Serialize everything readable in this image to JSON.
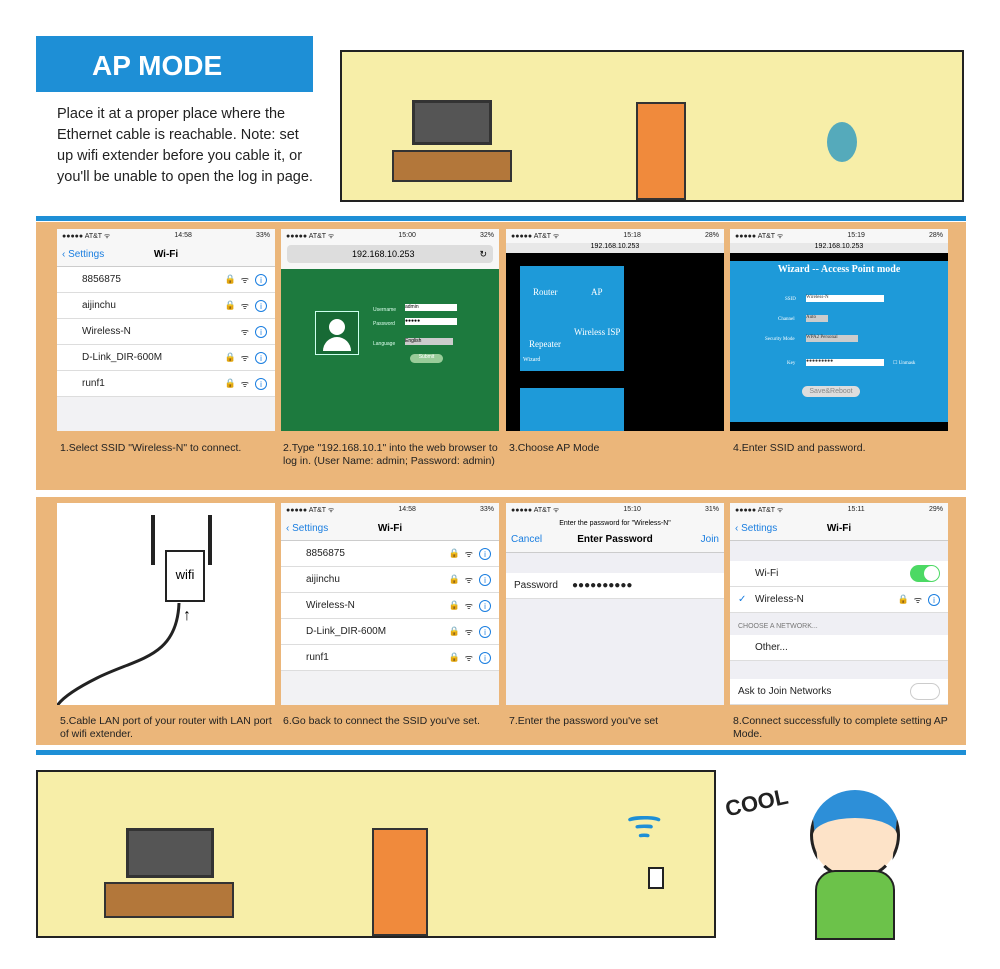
{
  "header": {
    "title": "AP MODE",
    "intro": "Place it at a proper place where the Ethernet cable is reachable. Note: set up wifi extender before you cable it, or you'll be unable to open the log in page."
  },
  "status": {
    "carrier": "●●●●● AT&T ᯤ"
  },
  "steps": [
    {
      "caption": "1.Select SSID \"Wireless-N\" to connect.",
      "time": "14:58",
      "battery": "33%",
      "back": "Settings",
      "title": "Wi-Fi",
      "networks": [
        "8856875",
        "aijinchu",
        "Wireless-N",
        "D-Link_DIR-600M",
        "runf1"
      ]
    },
    {
      "caption": "2.Type \"192.168.10.1\" into the web browser to log in. (User Name: admin; Password: admin)",
      "time": "15:00",
      "battery": "32%",
      "url": "192.168.10.253",
      "username_label": "Username",
      "username": "admin",
      "password_label": "Password",
      "password": "●●●●●",
      "language_label": "Language",
      "language": "English",
      "submit": "Submit"
    },
    {
      "caption": "3.Choose AP Mode",
      "time": "15:18",
      "battery": "28%",
      "url": "192.168.10.253",
      "modes": [
        "Router",
        "AP",
        "Wireless ISP",
        "Repeater",
        "Wizard"
      ]
    },
    {
      "caption": "4.Enter SSID and password.",
      "time": "15:19",
      "battery": "28%",
      "url": "192.168.10.253",
      "heading": "Wizard -- Access Point mode",
      "ssid_label": "SSID",
      "ssid": "Wireless-N",
      "channel_label": "Channel",
      "channel": "Auto",
      "security_label": "Security Mode",
      "security": "WPA2 Personal",
      "key_label": "Key",
      "key": "●●●●●●●●●",
      "unmask": "Unmask",
      "save": "Save&Reboot"
    },
    {
      "caption": "5.Cable LAN port of your router with LAN port of wifi extender.",
      "device_label": "wifi"
    },
    {
      "caption": "6.Go back to connect the SSID you've set.",
      "time": "14:58",
      "battery": "33%",
      "back": "Settings",
      "title": "Wi-Fi",
      "networks": [
        "8856875",
        "aijinchu",
        "Wireless-N",
        "D-Link_DIR-600M",
        "runf1"
      ]
    },
    {
      "caption": "7.Enter the password you've set",
      "time": "15:10",
      "battery": "31%",
      "prompt": "Enter the password for \"Wireless-N\"",
      "cancel": "Cancel",
      "title": "Enter Password",
      "join": "Join",
      "password_label": "Password",
      "password": "●●●●●●●●●●"
    },
    {
      "caption": "8.Connect successfully to complete setting AP Mode.",
      "time": "15:11",
      "battery": "29%",
      "back": "Settings",
      "title": "Wi-Fi",
      "wifi_label": "Wi-Fi",
      "connected": "Wireless-N",
      "choose": "CHOOSE A NETWORK...",
      "other": "Other...",
      "ask": "Ask to Join Networks"
    }
  ],
  "illustration": {
    "exclaim": "COOL"
  },
  "colors": {
    "blue": "#1e8fd6",
    "panel": "#ebb67a",
    "wall": "#f7eea8",
    "door": "#f08a3c",
    "green_page": "#1d7a3e"
  }
}
